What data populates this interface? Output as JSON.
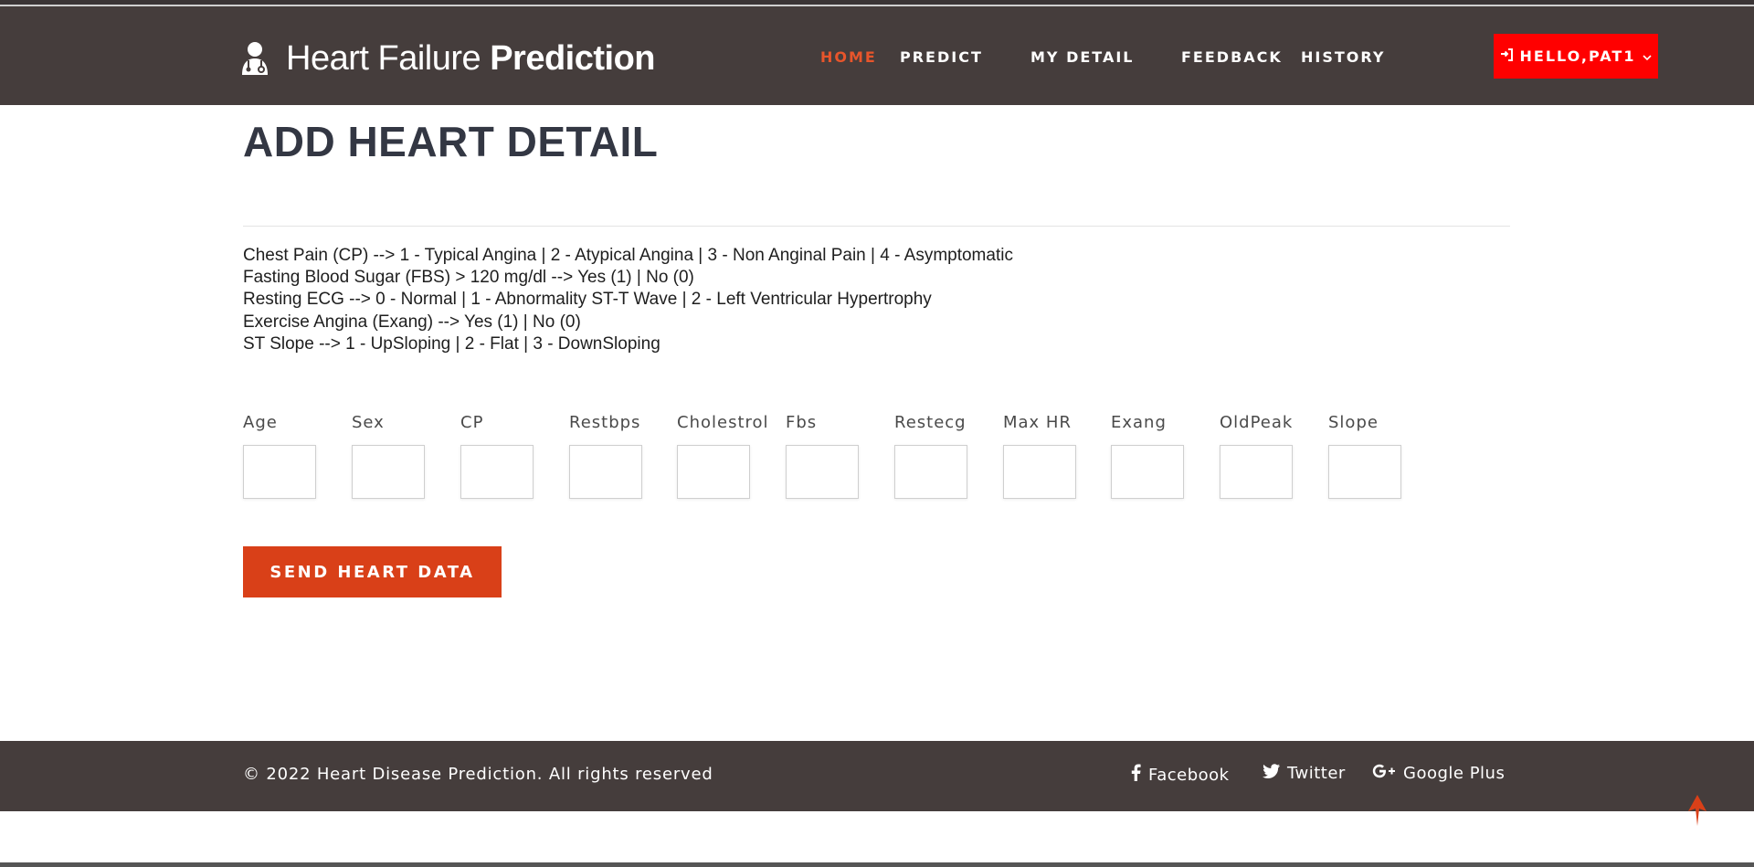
{
  "brand": {
    "title_light": "Heart Failure ",
    "title_bold": "Prediction",
    "icon": "doctor-icon"
  },
  "nav": {
    "items": [
      {
        "label": "HOME",
        "active": true
      },
      {
        "label": "PREDICT",
        "active": false
      },
      {
        "label": "MY DETAIL",
        "active": false
      },
      {
        "label": "FEEDBACK",
        "active": false
      },
      {
        "label": "HISTORY",
        "active": false
      }
    ],
    "user_button": {
      "label": "HELLO,PAT1",
      "icon": "login-icon",
      "caret_icon": "chevron-down-icon"
    },
    "active_color": "#e8552b",
    "user_button_color": "#ff0000"
  },
  "page": {
    "title": "ADD HEART DETAIL",
    "legend": [
      "Chest Pain (CP) --> 1 - Typical Angina | 2 - Atypical Angina | 3 - Non Anginal Pain | 4 - Asymptomatic",
      "Fasting Blood Sugar (FBS) > 120 mg/dl --> Yes (1) | No (0)",
      "Resting ECG --> 0 - Normal | 1 - Abnormality ST-T Wave | 2 - Left Ventricular Hypertrophy",
      "Exercise Angina (Exang) --> Yes (1) | No (0)",
      "ST Slope --> 1 - UpSloping | 2 - Flat | 3 - DownSloping"
    ],
    "fields": [
      {
        "label": "Age",
        "value": ""
      },
      {
        "label": "Sex",
        "value": ""
      },
      {
        "label": "CP",
        "value": ""
      },
      {
        "label": "Restbps",
        "value": ""
      },
      {
        "label": "Cholestrol",
        "value": ""
      },
      {
        "label": "Fbs",
        "value": ""
      },
      {
        "label": "Restecg",
        "value": ""
      },
      {
        "label": "Max HR",
        "value": ""
      },
      {
        "label": "Exang",
        "value": ""
      },
      {
        "label": "OldPeak",
        "value": ""
      },
      {
        "label": "Slope",
        "value": ""
      }
    ],
    "submit_label": "SEND HEART DATA",
    "submit_color": "#d94018"
  },
  "footer": {
    "copyright": "© 2022 Heart Disease Prediction. All rights reserved",
    "social": [
      {
        "label": "Facebook",
        "icon": "facebook-icon"
      },
      {
        "label": "Twitter",
        "icon": "twitter-icon"
      },
      {
        "label": "Google Plus",
        "icon": "google-plus-icon"
      }
    ],
    "background": "#453d3c"
  },
  "scroll_top": {
    "icon": "arrow-up-icon"
  }
}
